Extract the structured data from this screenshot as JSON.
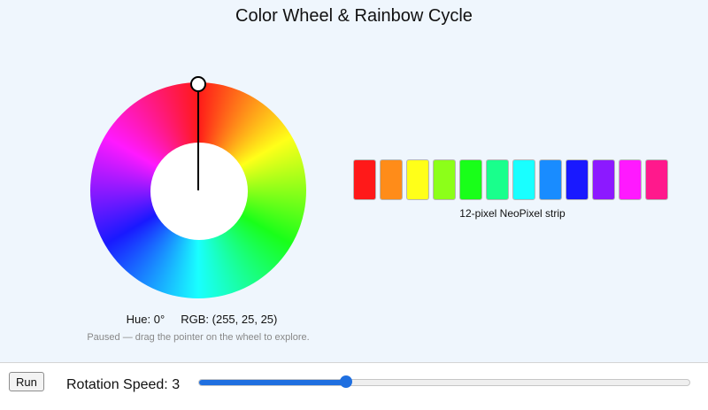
{
  "title": "Color Wheel & Rainbow Cycle",
  "wheel": {
    "pointer_hue_deg": 0,
    "readout_hue_label": "Hue:",
    "readout_hue_value": "0°",
    "readout_rgb_label": "RGB:",
    "readout_rgb_value": "(255, 25, 25)",
    "hint": "Paused — drag the pointer on the wheel to explore."
  },
  "strip": {
    "label": "12-pixel NeoPixel strip",
    "pixels": [
      "#ff1919",
      "#ff8c19",
      "#ffff19",
      "#8cff19",
      "#19ff19",
      "#19ff8c",
      "#19ffff",
      "#198cff",
      "#1919ff",
      "#8c19ff",
      "#ff19ff",
      "#ff198c"
    ]
  },
  "controls": {
    "run_label": "Run",
    "speed_label": "Rotation Speed:",
    "speed_value": "3",
    "slider_fraction": 0.3
  }
}
